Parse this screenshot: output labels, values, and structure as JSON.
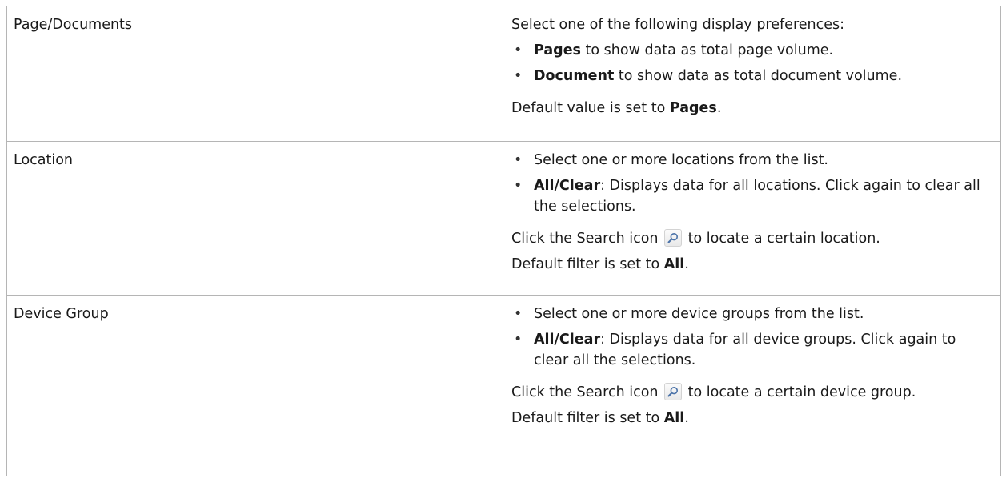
{
  "rows": [
    {
      "name": "Page/Documents",
      "intro": "Select one of the following display preferences:",
      "bullets": [
        {
          "bold": "Pages",
          "text": " to show data as total page volume."
        },
        {
          "bold": "Document",
          "text": " to show data as total document volume."
        }
      ],
      "footer": {
        "text": "Default value is set to ",
        "bold": "Pages",
        "tail": "."
      }
    },
    {
      "name": "Location",
      "bullets": [
        {
          "text": "Select one or more locations from the list."
        },
        {
          "bold": "All/Clear",
          "text": ": Displays data for all locations. Click again to clear all the selections."
        }
      ],
      "search": {
        "before": "Click the Search icon ",
        "after": " to locate a certain location."
      },
      "footer": {
        "text": "Default filter is set to ",
        "bold": "All",
        "tail": "."
      }
    },
    {
      "name": "Device Group",
      "bullets": [
        {
          "text": "Select one or more device groups from the list."
        },
        {
          "bold": "All/Clear",
          "text": ": Displays data for all device groups. Click again to clear all the selections."
        }
      ],
      "search": {
        "before": "Click the Search icon ",
        "after": " to locate a certain device group."
      },
      "footer": {
        "text": "Default filter is set to ",
        "bold": "All",
        "tail": "."
      }
    }
  ],
  "bullet_char": "•",
  "icons": {
    "search": "search-icon"
  }
}
